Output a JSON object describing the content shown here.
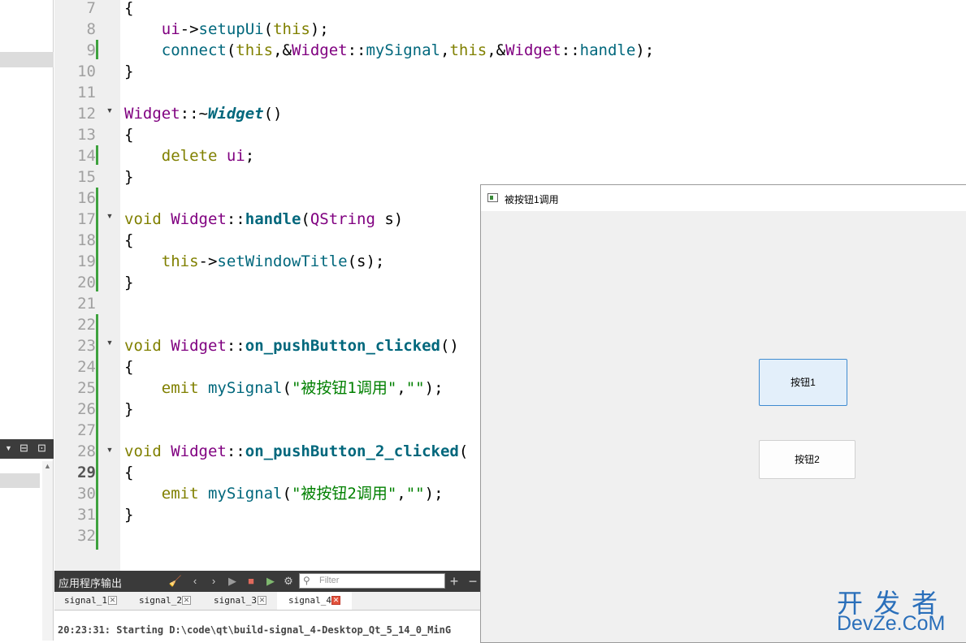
{
  "editor": {
    "line_numbers": [
      "7",
      "8",
      "9",
      "10",
      "11",
      "12",
      "13",
      "14",
      "15",
      "16",
      "17",
      "18",
      "19",
      "20",
      "21",
      "22",
      "23",
      "24",
      "25",
      "26",
      "27",
      "28",
      "29",
      "30",
      "31",
      "32"
    ],
    "current_line": "29",
    "code": {
      "l7": {
        "brace": "{"
      },
      "l8": {
        "a": "ui",
        "b": "->",
        "c": "setupUi",
        "d": "(",
        "e": "this",
        "f": ");"
      },
      "l9": {
        "a": "connect",
        "b": "(",
        "c": "this",
        "d": ",&",
        "e": "Widget",
        "f": "::",
        "g": "mySignal",
        "h": ",",
        "i": "this",
        "j": ",&",
        "k": "Widget",
        "l": "::",
        "m": "handle",
        "n": ");"
      },
      "l10": {
        "brace": "}"
      },
      "l12": {
        "a": "Widget",
        "b": "::~",
        "c": "Widget",
        "d": "()"
      },
      "l13": {
        "brace": "{"
      },
      "l14": {
        "a": "delete",
        "b": " ",
        "c": "ui",
        "d": ";"
      },
      "l15": {
        "brace": "}"
      },
      "l17": {
        "a": "void",
        "b": " ",
        "c": "Widget",
        "d": "::",
        "e": "handle",
        "f": "(",
        "g": "QString",
        "h": " s)"
      },
      "l18": {
        "brace": "{"
      },
      "l19": {
        "a": "this",
        "b": "->",
        "c": "setWindowTitle",
        "d": "(s);"
      },
      "l20": {
        "brace": "}"
      },
      "l23": {
        "a": "void",
        "b": " ",
        "c": "Widget",
        "d": "::",
        "e": "on_pushButton_clicked",
        "f": "()"
      },
      "l24": {
        "brace": "{"
      },
      "l25": {
        "a": "emit",
        "b": " ",
        "c": "mySignal",
        "d": "(",
        "e": "\"被按钮1调用\"",
        "f": ",",
        "g": "\"\"",
        "h": ");"
      },
      "l26": {
        "brace": "}"
      },
      "l28": {
        "a": "void",
        "b": " ",
        "c": "Widget",
        "d": "::",
        "e": "on_pushButton_2_clicked",
        "f": "("
      },
      "l29": {
        "brace": "{"
      },
      "l30": {
        "a": "emit",
        "b": " ",
        "c": "mySignal",
        "d": "(",
        "e": "\"被按钮2调用\"",
        "f": ",",
        "g": "\"\"",
        "h": ");"
      },
      "l31": {
        "brace": "}"
      }
    }
  },
  "output": {
    "title": "应用程序输出",
    "filter_placeholder": "Filter",
    "tabs": [
      {
        "label": "signal_1"
      },
      {
        "label": "signal_2"
      },
      {
        "label": "signal_3"
      },
      {
        "label": "signal_4"
      }
    ],
    "text": "20:23:31: Starting D:\\code\\qt\\build-signal_4-Desktop_Qt_5_14_0_MinG"
  },
  "app_window": {
    "title": "被按钮1调用",
    "button1": "按钮1",
    "button2": "按钮2"
  },
  "watermark": {
    "top": "开发者",
    "bottom": "DevZe.CoM"
  },
  "colors": {
    "keyword": "#808000",
    "type": "#800080",
    "function": "#00677c",
    "string": "#008000",
    "button_focus_border": "#3f8bd0",
    "watermark": "#2a6fba"
  }
}
